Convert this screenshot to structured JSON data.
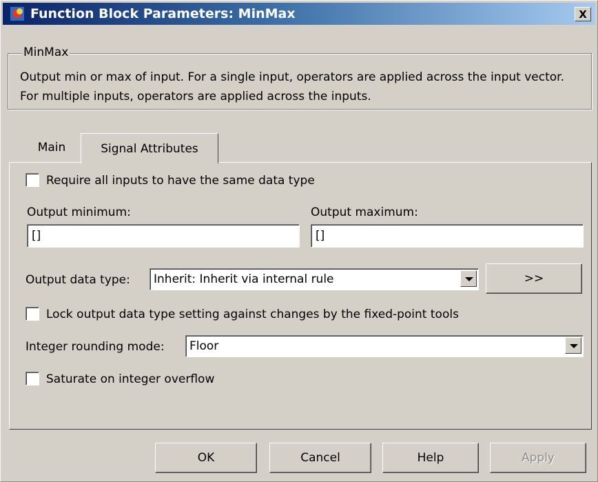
{
  "window": {
    "title": "Function Block Parameters: MinMax",
    "close_glyph": "X"
  },
  "group": {
    "legend": "MinMax",
    "description": "Output min or max of input.  For a single input, operators are applied across the input vector.  For multiple inputs, operators are applied across the inputs."
  },
  "tabs": [
    {
      "label": "Main",
      "active": false
    },
    {
      "label": "Signal Attributes",
      "active": true
    }
  ],
  "form": {
    "same_type_label": "Require all inputs to have the same data type",
    "same_type_checked": false,
    "out_min_label": "Output minimum:",
    "out_min_value": "[]",
    "out_max_label": "Output maximum:",
    "out_max_value": "[]",
    "data_type_label": "Output data type:",
    "data_type_value": "Inherit: Inherit via internal rule",
    "assistant_label": ">>",
    "lock_label": "Lock output data type setting against changes by the fixed-point tools",
    "lock_checked": false,
    "rounding_label": "Integer rounding mode:",
    "rounding_value": "Floor",
    "saturate_label": "Saturate on integer overflow",
    "saturate_checked": false
  },
  "buttons": {
    "ok": "OK",
    "cancel": "Cancel",
    "help": "Help",
    "apply": "Apply"
  },
  "colors": {
    "dialog_bg": "#d4d0c8",
    "titlebar_start": "#0a246a",
    "titlebar_end": "#a6caf0"
  }
}
